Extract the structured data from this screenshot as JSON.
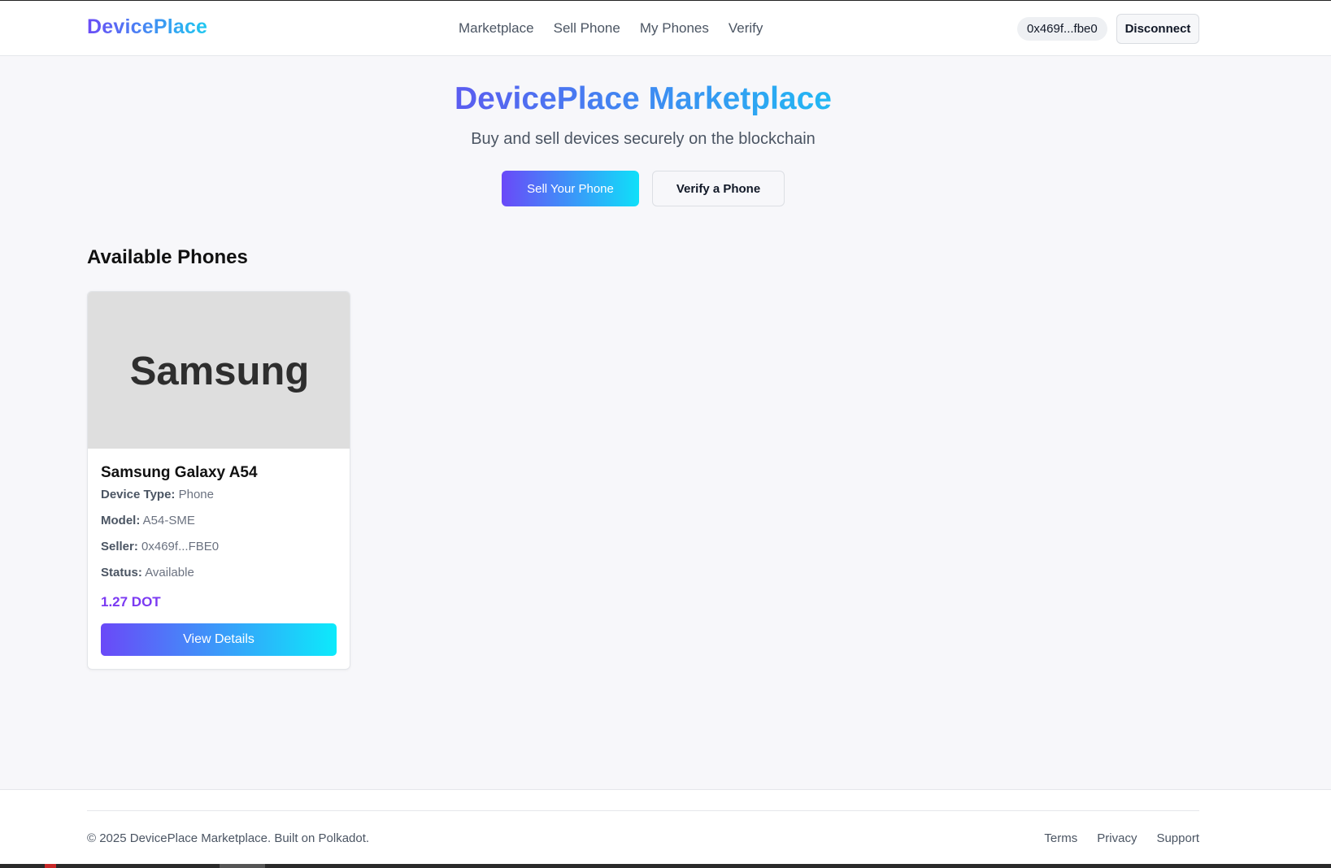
{
  "navbar": {
    "logo": "DevicePlace",
    "links": [
      "Marketplace",
      "Sell Phone",
      "My Phones",
      "Verify"
    ],
    "wallet_address": "0x469f...fbe0",
    "disconnect_label": "Disconnect"
  },
  "hero": {
    "title": "DevicePlace Marketplace",
    "subtitle": "Buy and sell devices securely on the blockchain",
    "primary_button": "Sell Your Phone",
    "secondary_button": "Verify a Phone"
  },
  "listings": {
    "section_title": "Available Phones",
    "items": [
      {
        "image_text": "Samsung",
        "name": "Samsung Galaxy A54",
        "device_type_label": "Device Type:",
        "device_type": "Phone",
        "model_label": "Model:",
        "model": "A54-SME",
        "seller_label": "Seller:",
        "seller": "0x469f...FBE0",
        "status_label": "Status:",
        "status": "Available",
        "price": "1.27 DOT",
        "button_label": "View Details"
      }
    ]
  },
  "footer": {
    "copyright": "© 2025 DevicePlace Marketplace. Built on Polkadot.",
    "links": [
      "Terms",
      "Privacy",
      "Support"
    ]
  },
  "colors": {
    "gradient_start": "#6a49f8",
    "gradient_end": "#0fe0f9",
    "price": "#7b3af2",
    "page_background": "#f7f7fa"
  }
}
